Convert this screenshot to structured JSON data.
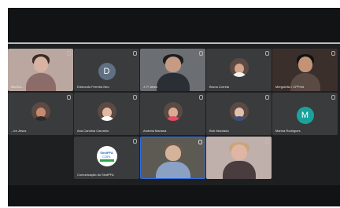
{
  "meeting": {
    "participants": [
      {
        "id": "p1",
        "name": "Bia Bor...",
        "initial": "",
        "mic": "muted"
      },
      {
        "id": "p2",
        "name": "Edmundo Ferreira Neu",
        "initial": "D",
        "mic": "muted",
        "avatar_color": "#5f7082"
      },
      {
        "id": "p3",
        "name": "J. P. Alves",
        "initial": "",
        "mic": "muted"
      },
      {
        "id": "p4",
        "name": "Bruna Correia",
        "initial": "",
        "mic": "muted"
      },
      {
        "id": "p5",
        "name": "Mergulhão / CPPrint",
        "initial": "",
        "mic": "muted"
      },
      {
        "id": "p6",
        "name": "...ira Jesus",
        "initial": "",
        "mic": "muted"
      },
      {
        "id": "p7",
        "name": "Ana Carolina Carvalho",
        "initial": "",
        "mic": "muted"
      },
      {
        "id": "p8",
        "name": "Andreia Mariana",
        "initial": "",
        "mic": "muted"
      },
      {
        "id": "p9",
        "name": "Bob Machado",
        "initial": "",
        "mic": "muted"
      },
      {
        "id": "p10",
        "name": "Marina Rodrigues",
        "initial": "M",
        "mic": "muted",
        "avatar_color": "#1aa39b"
      },
      {
        "id": "p11",
        "name": "Comunicação do SindPFA",
        "initial": "",
        "mic": "muted",
        "logo": {
          "line1": "SindPFA",
          "line2": "COPL"
        }
      },
      {
        "id": "p12",
        "name": "",
        "initial": "",
        "mic": "on"
      },
      {
        "id": "p13",
        "name": "",
        "initial": "",
        "mic": "muted"
      }
    ]
  }
}
